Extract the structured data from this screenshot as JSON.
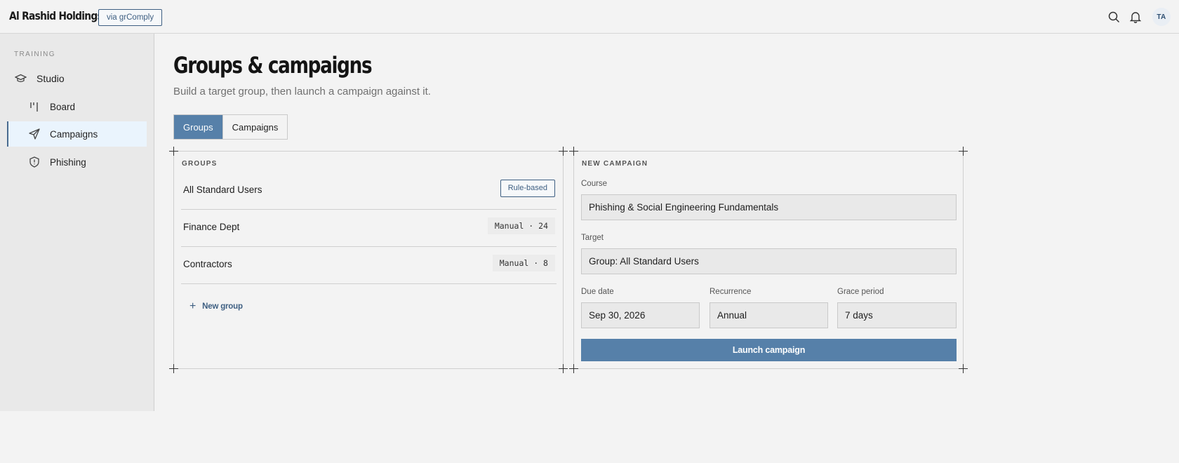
{
  "header": {
    "brand": "Al Rashid Holdings",
    "via_badge": "via grComply",
    "icons": [
      "search-icon",
      "bell-icon"
    ],
    "avatar_initials": "TA"
  },
  "sidebar": {
    "section": "TRAINING",
    "items": [
      {
        "label": "Studio",
        "icon": "graduation-cap-icon",
        "level": "top"
      },
      {
        "label": "Board",
        "icon": "board-columns-icon",
        "level": "sub"
      },
      {
        "label": "Campaigns",
        "icon": "send-icon",
        "level": "sub",
        "active": true
      },
      {
        "label": "Phishing",
        "icon": "shield-alert-icon",
        "level": "sub"
      }
    ]
  },
  "main": {
    "title": "Groups & campaigns",
    "subtitle": "Build a target group, then launch a campaign against it.",
    "tabs": [
      {
        "label": "Groups",
        "active": true
      },
      {
        "label": "Campaigns",
        "active": false
      }
    ],
    "groups_panel": {
      "label": "GROUPS",
      "rows": [
        {
          "name": "All Standard Users",
          "tag": "Rule-based",
          "tag_style": "outline"
        },
        {
          "name": "Finance Dept",
          "tag": "Manual · 24",
          "tag_style": "mono"
        },
        {
          "name": "Contractors",
          "tag": "Manual · 8",
          "tag_style": "mono"
        }
      ],
      "new_group_label": "New group"
    },
    "campaign_panel": {
      "label": "NEW CAMPAIGN",
      "course_label": "Course",
      "course_value": "Phishing & Social Engineering Fundamentals",
      "target_label": "Target",
      "target_value": "Group: All Standard Users",
      "due_label": "Due date",
      "due_value": "Sep 30, 2026",
      "recurrence_label": "Recurrence",
      "recurrence_value": "Annual",
      "grace_label": "Grace period",
      "grace_value": "7 days",
      "launch_label": "Launch campaign"
    }
  },
  "colors": {
    "accent": "#5680a9",
    "accent_dark": "#3e5f82",
    "background": "#f3f3f3",
    "sidebar_bg": "#e9e9e9",
    "active_item_bg": "#eaf4fd"
  }
}
